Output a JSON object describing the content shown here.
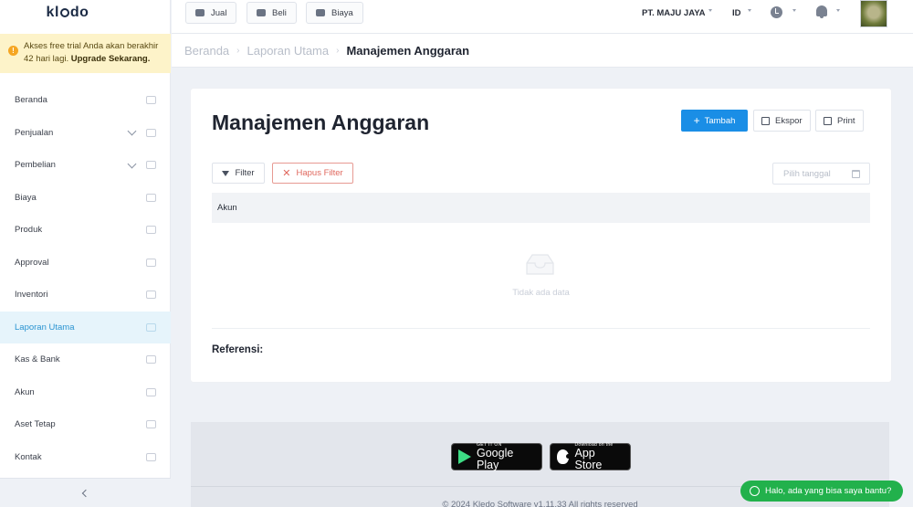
{
  "sidebar": {
    "logo": "kledo",
    "trial_notice": {
      "text": "Akses free trial Anda akan berakhir 42 hari lagi.",
      "link": "Upgrade Sekarang."
    },
    "items": [
      {
        "label": "Beranda",
        "icon": "home-icon"
      },
      {
        "label": "Penjualan",
        "icon": "shop-basket-icon"
      },
      {
        "label": "Pembelian",
        "icon": "shopping-bag-icon"
      },
      {
        "label": "Biaya",
        "icon": "credit-card-icon"
      },
      {
        "label": "Produk",
        "icon": "box-icon"
      },
      {
        "label": "Approval",
        "icon": "check-icon"
      },
      {
        "label": "Inventori",
        "icon": "warehouse-icon"
      },
      {
        "label": "Laporan Utama",
        "icon": "chart-icon"
      },
      {
        "label": "Kas & Bank",
        "icon": "dollar-icon"
      },
      {
        "label": "Akun",
        "icon": "ledger-icon"
      },
      {
        "label": "Aset Tetap",
        "icon": "building-icon"
      },
      {
        "label": "Kontak",
        "icon": "contact-card-icon"
      }
    ],
    "active_item": "Laporan Utama"
  },
  "topbar": {
    "quick_buttons": [
      "Jual",
      "Beli",
      "Biaya"
    ],
    "company": "PT. MAJU JAYA",
    "language": "ID"
  },
  "breadcrumb": {
    "items": [
      "Beranda",
      "Laporan Utama"
    ],
    "current": "Manajemen Anggaran"
  },
  "main": {
    "title": "Manajemen Anggaran",
    "actions": {
      "add": "Tambah",
      "export": "Ekspor",
      "print": "Print"
    },
    "filter_label": "Filter",
    "clear_filter_label": "Hapus Filter",
    "date_placeholder": "Pilih tanggal",
    "table_header": "Akun",
    "empty_text": "Tidak ada data",
    "reference_label": "Referensi:"
  },
  "footer": {
    "google_play": {
      "small": "GET IT ON",
      "big": "Google Play"
    },
    "app_store": {
      "small": "Download on the",
      "big": "App Store"
    },
    "copyright": "© 2024 Kledo Software v1.11.33 All rights reserved"
  },
  "help_chat": "Halo, ada yang bisa saya bantu?",
  "colors": {
    "primary": "#1a8ee6",
    "active_bg": "#e6f4fb",
    "active_text": "#2b94d1",
    "danger": "#e0685e",
    "trial_bg": "#fdf3c9",
    "whatsapp": "#22b14c"
  }
}
